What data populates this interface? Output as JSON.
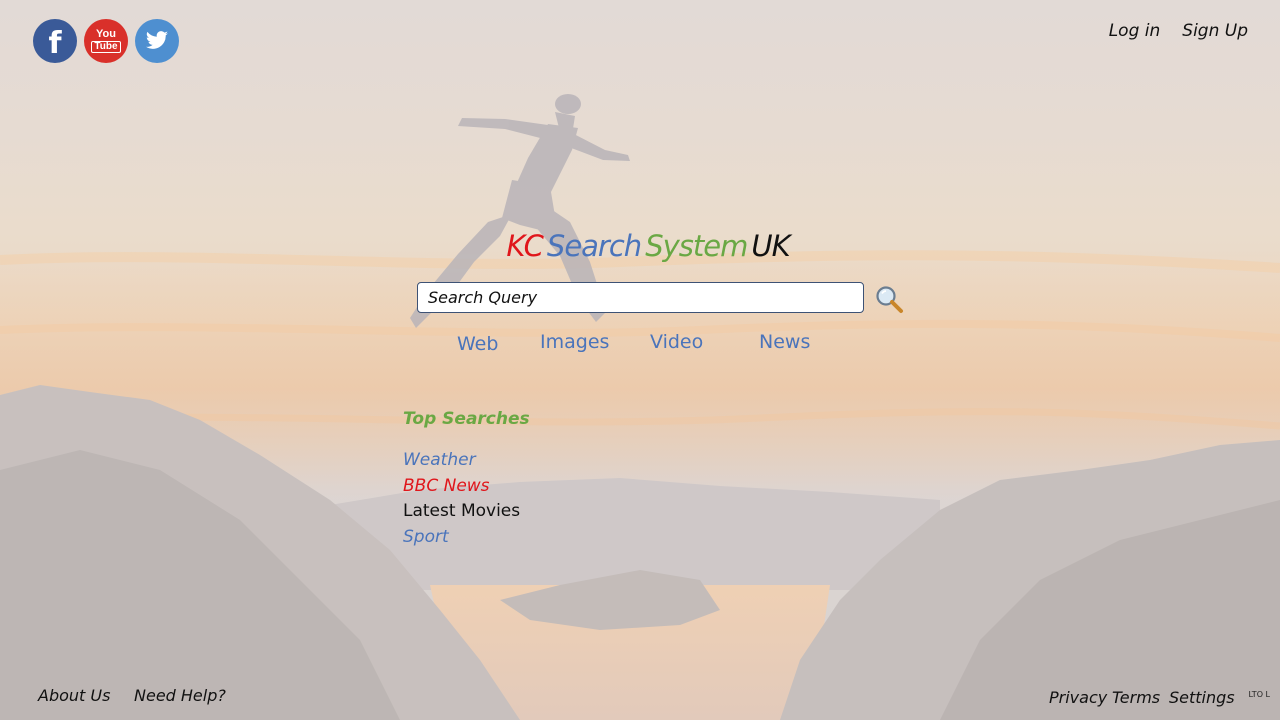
{
  "social": [
    {
      "name": "facebook",
      "icon": "facebook-icon",
      "glyph": "f",
      "color": "#3a5a98"
    },
    {
      "name": "youtube",
      "icon": "youtube-icon",
      "glyph_top": "You",
      "glyph_bottom": "Tube",
      "color": "#d9302a"
    },
    {
      "name": "twitter",
      "icon": "twitter-icon",
      "color": "#4e8fd0"
    }
  ],
  "header": {
    "login_label": "Log in",
    "signup_label": "Sign Up"
  },
  "brand": {
    "part1": "KC",
    "part2": "Search",
    "part3": "System",
    "part4": "UK",
    "colors": {
      "part1": "#e0161b",
      "part2": "#4a74bb",
      "part3": "#6aa844",
      "part4": "#111111"
    }
  },
  "search": {
    "placeholder": "Search Query",
    "value": "",
    "button_icon": "magnifier-icon"
  },
  "tabs": [
    {
      "label": "Web"
    },
    {
      "label": "Images"
    },
    {
      "label": "Video"
    },
    {
      "label": "News"
    }
  ],
  "top_searches": {
    "title": "Top Searches",
    "items": [
      {
        "label": "Weather",
        "color": "#4a74bb"
      },
      {
        "label": "BBC News",
        "color": "#e0161b"
      },
      {
        "label": "Latest Movies",
        "color": "#111111"
      },
      {
        "label": "Sport",
        "color": "#4a74bb"
      }
    ]
  },
  "footer": {
    "about_label": "About Us",
    "help_label": "Need Help?",
    "privacy_label": "Privacy",
    "terms_label": "Terms",
    "settings_label": "Settings",
    "tiny_text": "LTO L"
  }
}
